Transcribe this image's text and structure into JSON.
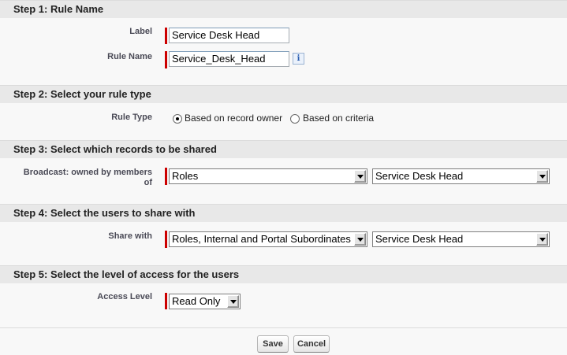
{
  "steps": {
    "step1_title": "Step 1: Rule Name",
    "step2_title": "Step 2: Select your rule type",
    "step3_title": "Step 3: Select which records to be shared",
    "step4_title": "Step 4: Select the users to share with",
    "step5_title": "Step 5: Select the level of access for the users"
  },
  "rule_name": {
    "label_label": "Label",
    "label_value": "Service Desk Head",
    "name_label": "Rule Name",
    "name_value": "Service_Desk_Head",
    "info_icon": "i"
  },
  "rule_type": {
    "label": "Rule Type",
    "option_owner": "Based on record owner",
    "option_criteria": "Based on criteria",
    "selected": "Based on record owner"
  },
  "records": {
    "label_line1": "Broadcast: owned by members",
    "label_line2": "of",
    "type_selected": "Roles",
    "value_selected": "Service Desk Head"
  },
  "share_with": {
    "label": "Share with",
    "type_selected": "Roles, Internal and Portal Subordinates",
    "value_selected": "Service Desk Head"
  },
  "access": {
    "label": "Access Level",
    "selected": "Read Only"
  },
  "buttons": {
    "save": "Save",
    "cancel": "Cancel"
  },
  "colors": {
    "required_marker": "#c00000",
    "section_header_bg": "#e8e8e8",
    "page_bg": "#f8f8f8"
  }
}
